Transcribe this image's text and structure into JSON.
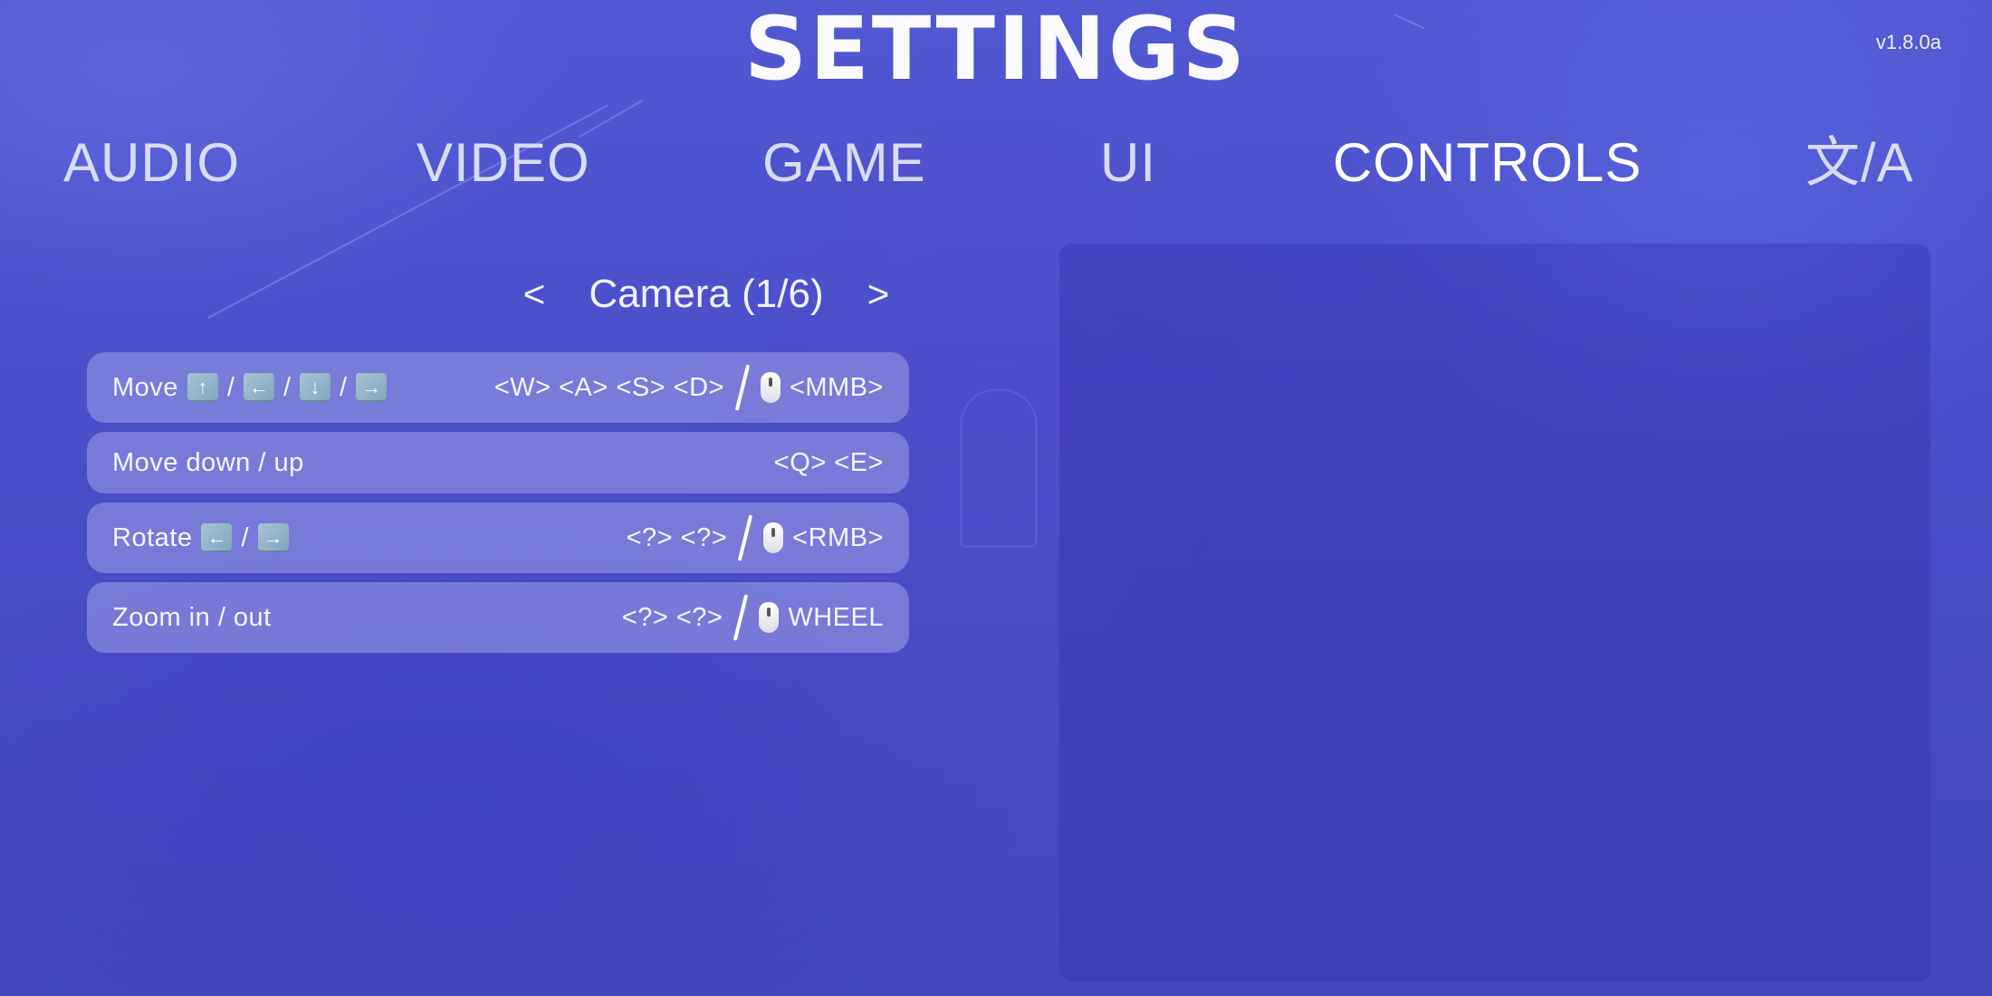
{
  "header": {
    "title": "SETTINGS",
    "version": "v1.8.0a"
  },
  "tabs": [
    {
      "label": "AUDIO",
      "active": false
    },
    {
      "label": "VIDEO",
      "active": false
    },
    {
      "label": "GAME",
      "active": false
    },
    {
      "label": "UI",
      "active": false
    },
    {
      "label": "CONTROLS",
      "active": true
    },
    {
      "label": "文/A",
      "active": false
    }
  ],
  "pager": {
    "prev_label": "<",
    "title": "Camera (1/6)",
    "next_label": ">"
  },
  "bindings": [
    {
      "action": "Move",
      "action_keys": [
        "up-arrow-key-icon",
        "left-arrow-key-icon",
        "down-arrow-key-icon",
        "right-arrow-key-icon"
      ],
      "action_key_glyphs": [
        "↑",
        "←",
        "↓",
        "→"
      ],
      "action_sep": "/",
      "keys": "<W> <A> <S> <D>",
      "mouse_icon": "mouse-icon",
      "mouse_binding": "<MMB>"
    },
    {
      "action": "Move down / up",
      "keys": "<Q> <E>"
    },
    {
      "action": "Rotate",
      "action_keys": [
        "left-arrow-key-icon",
        "right-arrow-key-icon"
      ],
      "action_key_glyphs": [
        "←",
        "→"
      ],
      "action_sep": "/",
      "keys": "<?> <?>",
      "mouse_icon": "mouse-icon",
      "mouse_binding": "<RMB>"
    },
    {
      "action": "Zoom in / out",
      "keys": "<?> <?>",
      "mouse_icon": "mouse-icon",
      "mouse_binding": "WHEEL"
    }
  ],
  "colors": {
    "background": "#4a4ec8",
    "row_background": "#8b8be0",
    "key_icon": "#8fb2c8",
    "text": "#ffffff",
    "inactive_tab": "#d9dcf6"
  }
}
